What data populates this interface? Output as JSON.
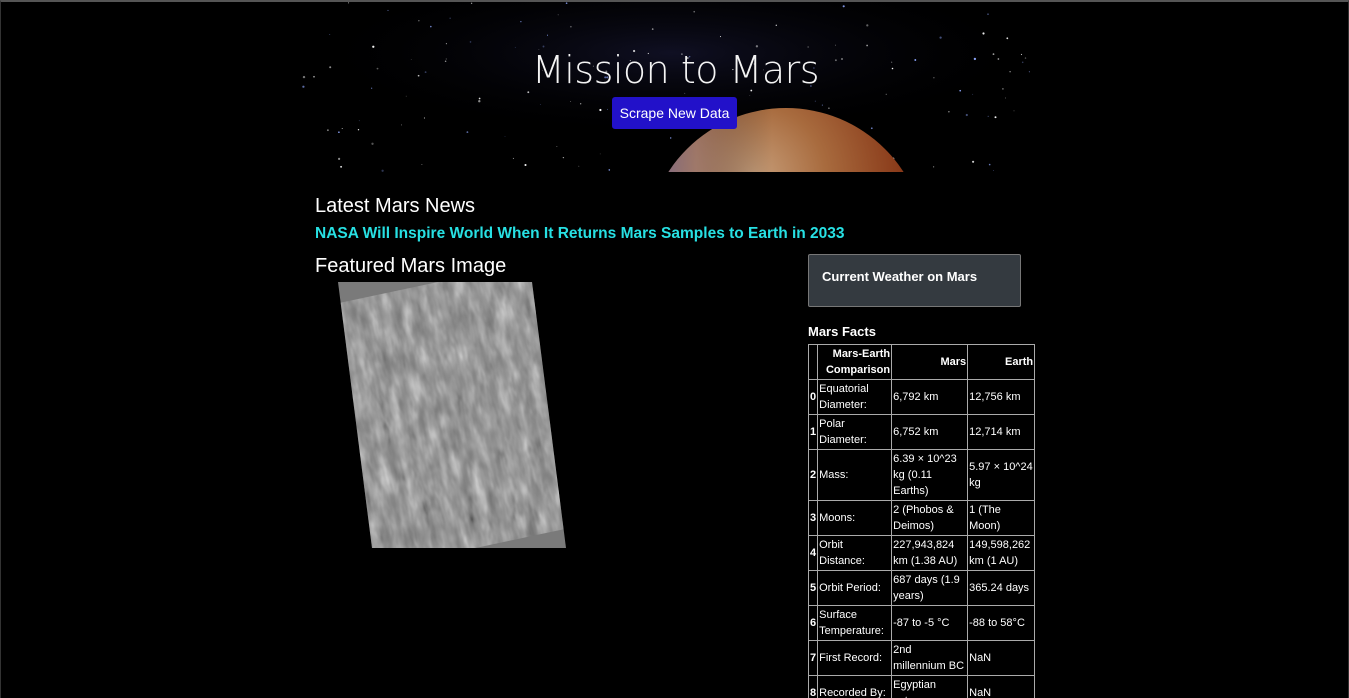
{
  "hero": {
    "title": "Mission to Mars",
    "button_label": "Scrape New Data"
  },
  "news": {
    "heading": "Latest Mars News",
    "title": "NASA Will Inspire World When It Returns Mars Samples to Earth in 2033"
  },
  "featured": {
    "heading": "Featured Mars Image"
  },
  "weather": {
    "heading": "Current Weather on Mars"
  },
  "facts": {
    "heading": "Mars Facts",
    "columns": [
      "",
      "Mars-Earth Comparison",
      "Mars",
      "Earth"
    ],
    "rows": [
      {
        "idx": "0",
        "label": "Equatorial Diameter:",
        "mars": "6,792 km",
        "earth": "12,756 km"
      },
      {
        "idx": "1",
        "label": "Polar Diameter:",
        "mars": "6,752 km",
        "earth": "12,714 km"
      },
      {
        "idx": "2",
        "label": "Mass:",
        "mars": "6.39 × 10^23 kg (0.11 Earths)",
        "earth": "5.97 × 10^24 kg"
      },
      {
        "idx": "3",
        "label": "Moons:",
        "mars": "2 (Phobos & Deimos)",
        "earth": "1 (The Moon)"
      },
      {
        "idx": "4",
        "label": "Orbit Distance:",
        "mars": "227,943,824 km (1.38 AU)",
        "earth": "149,598,262 km (1 AU)"
      },
      {
        "idx": "5",
        "label": "Orbit Period:",
        "mars": "687 days (1.9 years)",
        "earth": "365.24 days"
      },
      {
        "idx": "6",
        "label": "Surface Temperature:",
        "mars": "-87 to -5 °C",
        "earth": "-88 to 58°C"
      },
      {
        "idx": "7",
        "label": "First Record:",
        "mars": "2nd millennium BC",
        "earth": "NaN"
      },
      {
        "idx": "8",
        "label": "Recorded By:",
        "mars": "Egyptian astronomers",
        "earth": "NaN"
      }
    ]
  },
  "colors": {
    "background": "#000000",
    "button": "#2211c9",
    "news_link": "#27e0e3",
    "weather_box": "#343a40"
  }
}
